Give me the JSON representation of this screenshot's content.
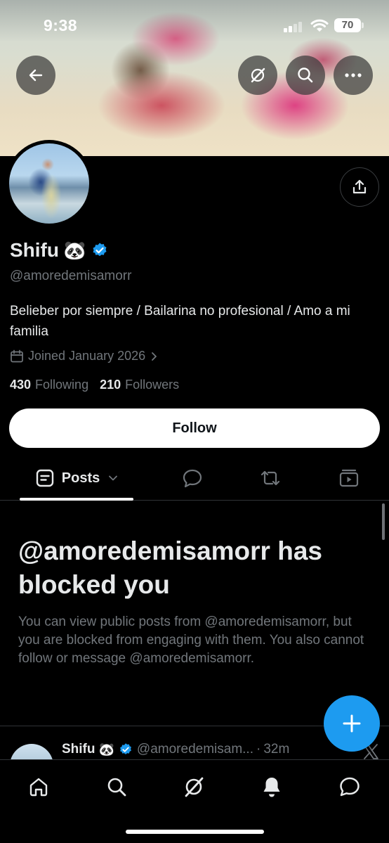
{
  "status_bar": {
    "time": "9:38",
    "battery": "70"
  },
  "profile": {
    "name": "Shifu",
    "name_emoji": "🐼",
    "handle": "@amoredemisamorr",
    "bio": "Belieber por siempre / Bailarina no profesional / Amo a mi familia",
    "joined": "Joined January 2026",
    "following_count": "430",
    "following_label": "Following",
    "followers_count": "210",
    "followers_label": "Followers"
  },
  "actions": {
    "follow_label": "Follow"
  },
  "tabs": {
    "posts_label": "Posts"
  },
  "blocked": {
    "title": "@amoredemisamorr has blocked you",
    "description": "You can view public posts from @amoredemisamorr, but you are blocked from engaging with them. You also cannot follow or message @amoredemisamorr."
  },
  "post": {
    "name": "Shifu",
    "emoji": "🐼",
    "handle": "@amoredemisam...",
    "separator": "·",
    "time": "32m"
  },
  "colors": {
    "accent": "#1d9bf0",
    "muted": "#71767b",
    "background": "#000000"
  }
}
